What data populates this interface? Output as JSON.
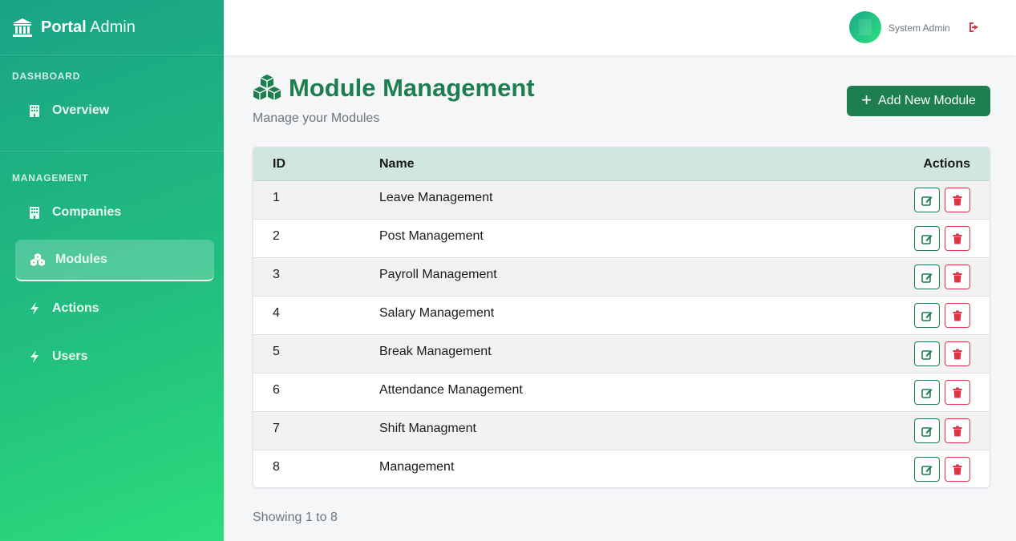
{
  "brand": {
    "name_bold": "Portal",
    "name_light": " Admin"
  },
  "sidebar": {
    "sections": [
      {
        "label": "DASHBOARD",
        "items": [
          {
            "label": "Overview",
            "icon": "building-icon"
          }
        ]
      },
      {
        "label": "MANAGEMENT",
        "items": [
          {
            "label": "Companies",
            "icon": "building-icon"
          },
          {
            "label": "Modules",
            "icon": "cubes-icon",
            "active": true
          },
          {
            "label": "Actions",
            "icon": "bolt-icon"
          },
          {
            "label": "Users",
            "icon": "bolt-icon"
          }
        ]
      }
    ]
  },
  "topbar": {
    "user_name": "System Admin",
    "logout_icon": "sign-out-icon"
  },
  "page": {
    "title": "Module Management",
    "subtitle": "Manage your Modules",
    "add_button": "Add New Module"
  },
  "table": {
    "headers": {
      "id": "ID",
      "name": "Name",
      "actions": "Actions"
    },
    "rows": [
      {
        "id": "1",
        "name": "Leave Management"
      },
      {
        "id": "2",
        "name": "Post Management"
      },
      {
        "id": "3",
        "name": "Payroll Management"
      },
      {
        "id": "4",
        "name": "Salary Management"
      },
      {
        "id": "5",
        "name": "Break Management"
      },
      {
        "id": "6",
        "name": "Attendance Management"
      },
      {
        "id": "7",
        "name": "Shift Managment"
      },
      {
        "id": "8",
        "name": "Management"
      }
    ]
  },
  "footer": {
    "showing": "Showing 1 to 8"
  },
  "colors": {
    "primary": "#1d7e4f",
    "danger": "#dc3545",
    "table_header": "#d1e7dd"
  }
}
